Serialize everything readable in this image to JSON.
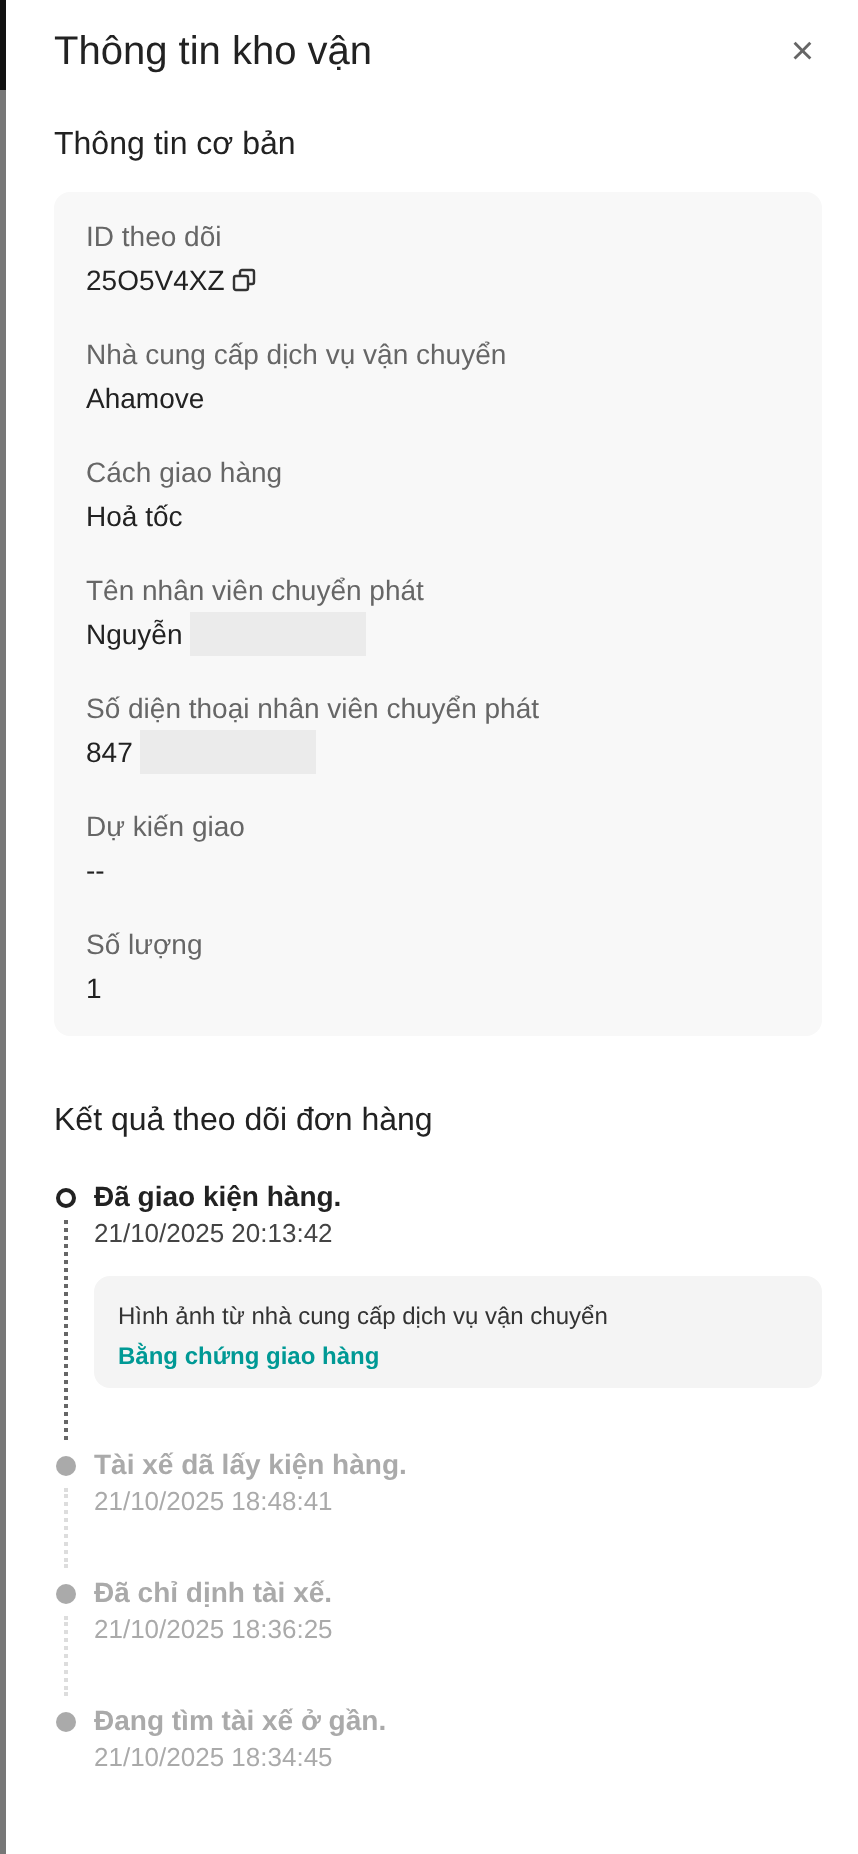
{
  "drawer": {
    "title": "Thông tin kho vận",
    "close": "×"
  },
  "basic_info": {
    "heading": "Thông tin cơ bản",
    "fields": [
      {
        "label": "ID theo dõi",
        "value": "25O5V4XZ",
        "copyable": true
      },
      {
        "label": "Nhà cung cấp dịch vụ vận chuyển",
        "value": "Ahamove"
      },
      {
        "label": "Cách giao hàng",
        "value": "Hoả tốc"
      },
      {
        "label": "Tên nhân viên chuyển phát",
        "value": "Nguyễn",
        "redacted": true
      },
      {
        "label": "Số diện thoại nhân viên chuyển phát",
        "value": "847",
        "redacted": true
      },
      {
        "label": "Dự kiến giao",
        "value": "--"
      },
      {
        "label": "Số lượng",
        "value": "1"
      }
    ]
  },
  "tracking": {
    "heading": "Kết quả theo dõi đơn hàng",
    "events": [
      {
        "title": "Đã giao kiện hàng.",
        "time": "21/10/2025 20:13:42",
        "current": true,
        "proof": {
          "caption": "Hình ảnh từ nhà cung cấp dịch vụ vận chuyển",
          "link": "Bằng chứng giao hàng"
        }
      },
      {
        "title": "Tài xế dã lấy kiện hàng.",
        "time": "21/10/2025 18:48:41",
        "current": false
      },
      {
        "title": "Đã chỉ dịnh tài xế.",
        "time": "21/10/2025 18:36:25",
        "current": false
      },
      {
        "title": "Đang tìm tài xế ở gần.",
        "time": "21/10/2025 18:34:45",
        "current": false
      }
    ]
  }
}
